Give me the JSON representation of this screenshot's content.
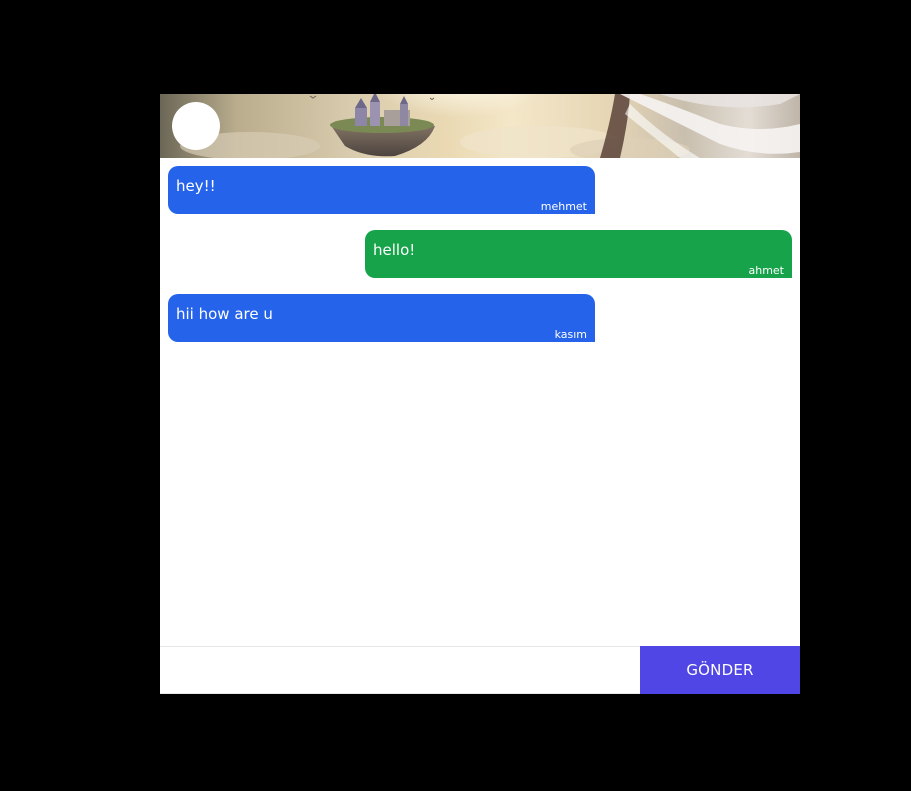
{
  "header": {
    "avatar_color": "#ffffff",
    "banner_image": "fantasy-castle-banner"
  },
  "messages": [
    {
      "text": "hey!!",
      "sender": "mehmet",
      "direction": "incoming",
      "color": "#2563eb"
    },
    {
      "text": "hello!",
      "sender": "ahmet",
      "direction": "outgoing",
      "color": "#16a34a"
    },
    {
      "text": "hii how are u",
      "sender": "kasım",
      "direction": "incoming",
      "color": "#2563eb"
    }
  ],
  "composer": {
    "input_value": "",
    "input_placeholder": "",
    "send_label": "GÖNDER",
    "send_color": "#4f46e5"
  }
}
